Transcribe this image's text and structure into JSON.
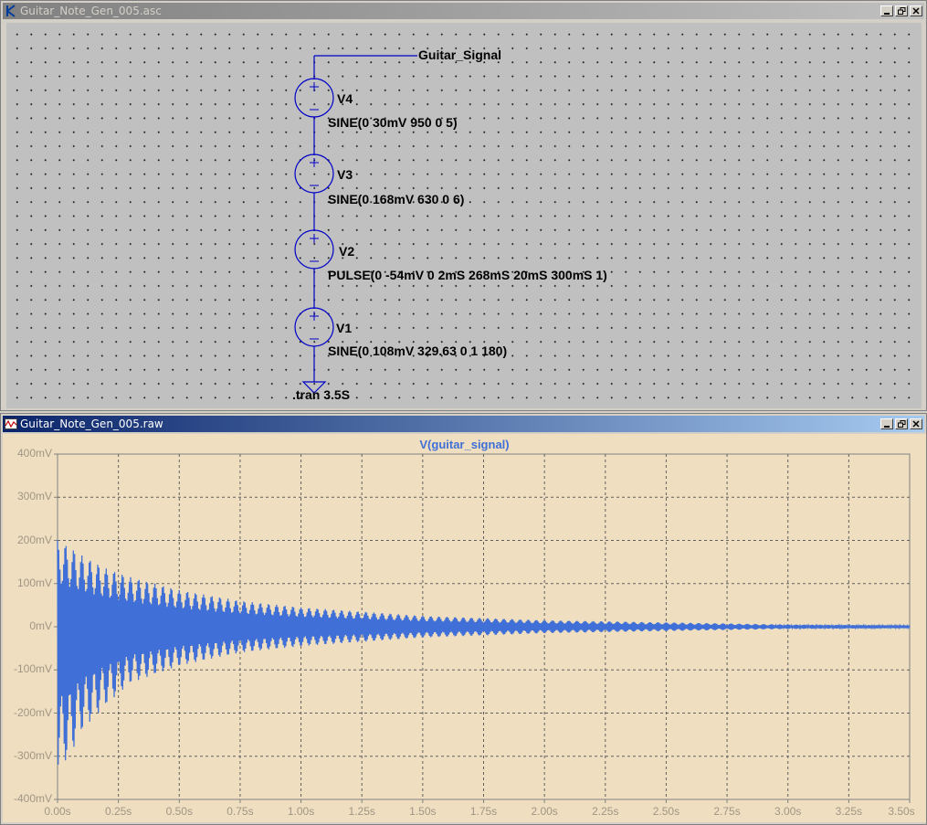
{
  "schematic_window": {
    "title": "Guitar_Note_Gen_005.asc",
    "net_label": "Guitar_Signal",
    "components": [
      {
        "name": "V4",
        "value": "SINE(0 30mV 950 0 5)"
      },
      {
        "name": "V3",
        "value": "SINE(0 168mV 630 0 6)"
      },
      {
        "name": "V2",
        "value": "PULSE(0 -54mV 0 2mS 268mS 20mS 300mS 1)"
      },
      {
        "name": "V1",
        "value": "SINE(0 108mV 329.63 0 1 180)"
      }
    ],
    "directive": ".tran 3.5S",
    "colors": {
      "wire": "#0000c8",
      "background": "#c0c0c0"
    }
  },
  "waveform_window": {
    "title": "Guitar_Note_Gen_005.raw",
    "colors": {
      "trace": "#3f6fd7",
      "background": "#efdfc0",
      "grid": "#606060"
    }
  },
  "chart_data": {
    "type": "line",
    "title": "V(guitar_signal)",
    "xlabel": "",
    "ylabel": "",
    "x_ticks": [
      "0.00s",
      "0.25s",
      "0.50s",
      "0.75s",
      "1.00s",
      "1.25s",
      "1.50s",
      "1.75s",
      "2.00s",
      "2.25s",
      "2.50s",
      "2.75s",
      "3.00s",
      "3.25s",
      "3.50s"
    ],
    "y_ticks": [
      "400mV",
      "300mV",
      "200mV",
      "100mV",
      "0mV",
      "-100mV",
      "-200mV",
      "-300mV",
      "-400mV"
    ],
    "xlim": [
      0,
      3.5
    ],
    "ylim": [
      -400,
      400
    ],
    "grid": true,
    "series": [
      {
        "name": "V(guitar_signal)",
        "envelope_x": [
          0.0,
          0.05,
          0.1,
          0.2,
          0.3,
          0.5,
          0.75,
          1.0,
          1.5,
          2.0,
          2.5,
          3.0,
          3.5
        ],
        "envelope_max": [
          200,
          185,
          165,
          135,
          115,
          85,
          60,
          45,
          25,
          15,
          10,
          5,
          3
        ],
        "envelope_min": [
          -330,
          -300,
          -240,
          -180,
          -130,
          -90,
          -60,
          -45,
          -25,
          -15,
          -10,
          -5,
          -3
        ]
      }
    ]
  }
}
